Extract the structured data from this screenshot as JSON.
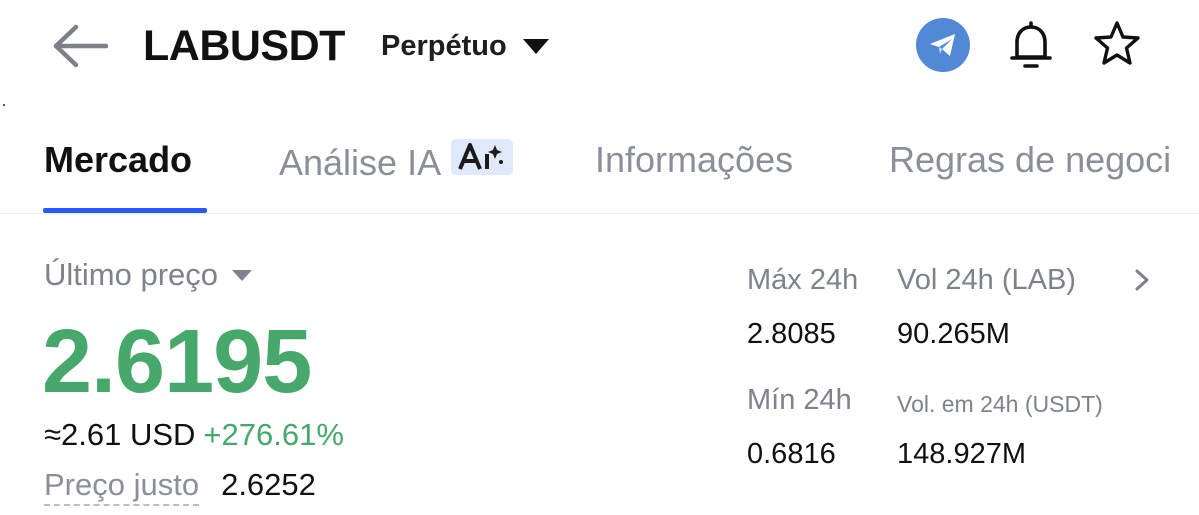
{
  "header": {
    "symbol": "LABUSDT",
    "contract_type": "Perpétuo",
    "icons": {
      "back": "arrow-left-icon",
      "telegram": "telegram-icon",
      "bell": "bell-icon",
      "star": "star-icon"
    },
    "colors": {
      "telegram_bg": "#5289d6"
    }
  },
  "tabs": [
    {
      "label": "Mercado",
      "active": true
    },
    {
      "label": "Análise IA",
      "badge": "AI"
    },
    {
      "label": "Informações"
    },
    {
      "label": "Regras de negoci"
    }
  ],
  "price": {
    "type_label": "Último preço",
    "last": "2.6195",
    "approx_usd": "≈2.61 USD",
    "change_pct": "+276.61%",
    "fair_label": "Preço justo",
    "fair_value": "2.6252",
    "colors": {
      "up": "#46a86a",
      "accent": "#2b59ff"
    }
  },
  "stats": {
    "high_label": "Máx 24h",
    "high_value": "2.8085",
    "vol_base_label": "Vol 24h (LAB)",
    "vol_base_value": "90.265M",
    "low_label": "Mín 24h",
    "low_value": "0.6816",
    "vol_quote_label": "Vol. em 24h (USDT)",
    "vol_quote_value": "148.927M"
  }
}
